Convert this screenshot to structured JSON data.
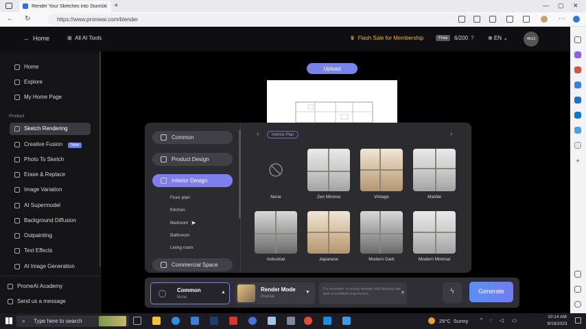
{
  "browser": {
    "tab_title": "Render Your Sketches into Stunni",
    "url": "https://www.promeai.com/blender"
  },
  "header": {
    "back_label": "Home",
    "all_tools_label": "All AI Tools",
    "flash_sale": "Flash Sale for Membership",
    "free_badge": "Free",
    "credits": "6/200",
    "language": "EN",
    "avatar_text": "4613"
  },
  "sidebar": {
    "top_items": [
      {
        "label": "Home",
        "icon": "home-icon"
      },
      {
        "label": "Explore",
        "icon": "compass-icon"
      },
      {
        "label": "My Home Page",
        "icon": "user-icon"
      }
    ],
    "section_label": "Product",
    "items": [
      {
        "label": "Sketch Rendering",
        "icon": "pen-icon"
      },
      {
        "label": "Creative Fusion",
        "icon": "fusion-icon",
        "badge": "New"
      },
      {
        "label": "Photo To Sketch",
        "icon": "photo-icon"
      },
      {
        "label": "Erase & Replace",
        "icon": "eraser-icon"
      },
      {
        "label": "Image Variation",
        "icon": "variation-icon"
      },
      {
        "label": "AI Supermodel",
        "icon": "model-icon"
      },
      {
        "label": "Background Diffusion",
        "icon": "background-icon"
      },
      {
        "label": "Outpainting",
        "icon": "expand-icon"
      },
      {
        "label": "Text Effects",
        "icon": "text-icon"
      },
      {
        "label": "AI Image Generation",
        "icon": "image-icon"
      }
    ],
    "bottom_items": [
      {
        "label": "PromeAI Academy",
        "icon": "academy-icon"
      },
      {
        "label": "Send us a message",
        "icon": "send-icon"
      }
    ]
  },
  "main": {
    "upload_label": "Upload"
  },
  "style_panel": {
    "categories": [
      "Common",
      "Product Design",
      "Interior Design",
      "Commercial Space"
    ],
    "sub_items": [
      "Floor plan",
      "Kitchen",
      "Bedroom",
      "Bathroom",
      "Living room"
    ],
    "tag": "Interior Plan",
    "styles": [
      {
        "label": "None"
      },
      {
        "label": "Zen Minima"
      },
      {
        "label": "Vintage"
      },
      {
        "label": "Marble"
      },
      {
        "label": "Industrial"
      },
      {
        "label": "Japanese"
      },
      {
        "label": "Modern Dark"
      },
      {
        "label": "Modern Minimal"
      }
    ]
  },
  "toolbar": {
    "mode_title": "Common",
    "mode_sub": "None",
    "render_title": "Render Mode",
    "render_sub": "Precise",
    "prompt_placeholder": "For example: a young woman with flowing hair and a confident expression",
    "generate_label": "Generate"
  },
  "taskbar": {
    "search_placeholder": "Type here to search",
    "weather": "29°C  Sunny",
    "time": "10:14 AM",
    "date": "9/19/2023"
  },
  "colors": {
    "accent": "#7d7ef0",
    "flash_sale": "#f5b342",
    "generate_start": "#5a8ff5"
  }
}
